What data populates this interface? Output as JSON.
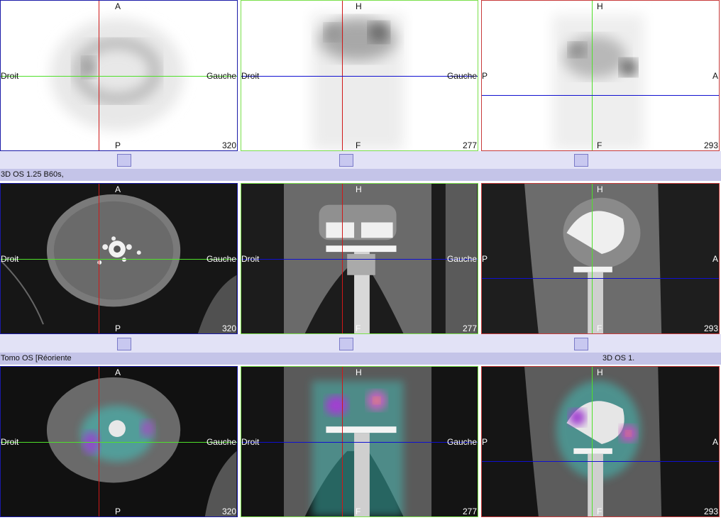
{
  "rows": [
    {
      "name": "spect",
      "views": [
        {
          "top": "A",
          "bottom": "P",
          "left": "Droit",
          "right": "Gauche",
          "slice": "320"
        },
        {
          "top": "H",
          "bottom": "F",
          "left": "Droit",
          "right": "Gauche",
          "slice": "277"
        },
        {
          "top": "H",
          "bottom": "F",
          "left": "P",
          "right": "A",
          "slice": "293"
        }
      ]
    },
    {
      "name": "ct",
      "views": [
        {
          "top": "A",
          "bottom": "P",
          "left": "Droit",
          "right": "Gauche",
          "slice": "320"
        },
        {
          "top": "H",
          "bottom": "F",
          "left": "Droit",
          "right": "Gauche",
          "slice": "277"
        },
        {
          "top": "H",
          "bottom": "F",
          "left": "P",
          "right": "A",
          "slice": "293"
        }
      ]
    },
    {
      "name": "fusion",
      "views": [
        {
          "top": "A",
          "bottom": "P",
          "left": "Droit",
          "right": "Gauche",
          "slice": "320"
        },
        {
          "top": "H",
          "bottom": "F",
          "left": "Droit",
          "right": "Gauche",
          "slice": "277"
        },
        {
          "top": "H",
          "bottom": "F",
          "left": "P",
          "right": "A",
          "slice": "293"
        }
      ]
    }
  ],
  "series_titles": {
    "ct": "3D OS  1.25  B60s,",
    "fusion_left": "Tomo OS [Réoriente",
    "fusion_right": "3D OS  1."
  },
  "colors": {
    "border_axial": "#1a1aa8",
    "border_coronal": "#79e04a",
    "border_sagittal": "#c83a3a",
    "crosshair_red": "#d01818",
    "crosshair_green": "#4fe02a",
    "crosshair_blue": "#1010d0",
    "strip": "#e2e2f6",
    "title_bar": "#c4c4e8"
  }
}
